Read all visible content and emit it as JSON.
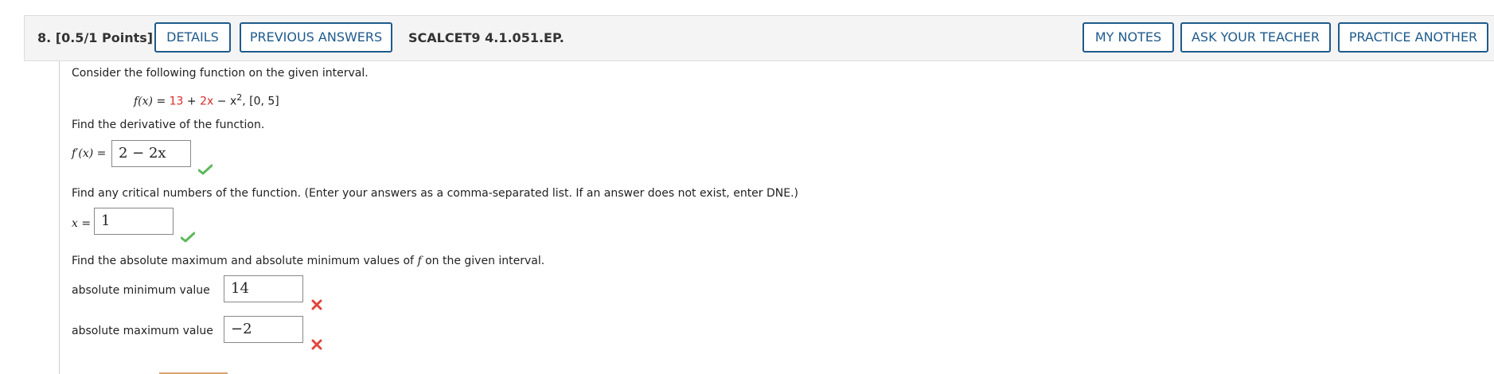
{
  "header": {
    "question_label": "8. [0.5/1 Points]",
    "details_label": "DETAILS",
    "previous_answers_label": "PREVIOUS ANSWERS",
    "problem_code": "SCALCET9 4.1.051.EP.",
    "my_notes_label": "MY NOTES",
    "ask_teacher_label": "ASK YOUR TEACHER",
    "practice_another_label": "PRACTICE ANOTHER"
  },
  "problem": {
    "intro": "Consider the following function on the given interval.",
    "function": {
      "lhs": "f(x) = ",
      "const": "13",
      "plus1": " + ",
      "linear": "2x",
      "minus": " − x",
      "exp": "2",
      "interval": ",    [0, 5]"
    },
    "part1_prompt": "Find the derivative of the function.",
    "part1_label": "f′(x) = ",
    "part1_answer": "2 − 2x",
    "part2_prompt": "Find any critical numbers of the function. (Enter your answers as a comma-separated list. If an answer does not exist, enter DNE.)",
    "part2_label": "x = ",
    "part2_answer": "1",
    "part3_prompt_pre": "Find the absolute maximum and absolute minimum values of ",
    "part3_prompt_var": "f",
    "part3_prompt_post": " on the given interval.",
    "abs_min_label": "absolute minimum value",
    "abs_min_answer": "14",
    "abs_max_label": "absolute maximum value",
    "abs_max_answer": "−2"
  },
  "colors": {
    "accent": "#1e5a8c",
    "correct": "#5cb85c",
    "incorrect": "#e0463c",
    "highlight": "#d62b2b"
  },
  "icons": {
    "correct": "checkmark-icon",
    "incorrect": "x-mark-icon"
  }
}
